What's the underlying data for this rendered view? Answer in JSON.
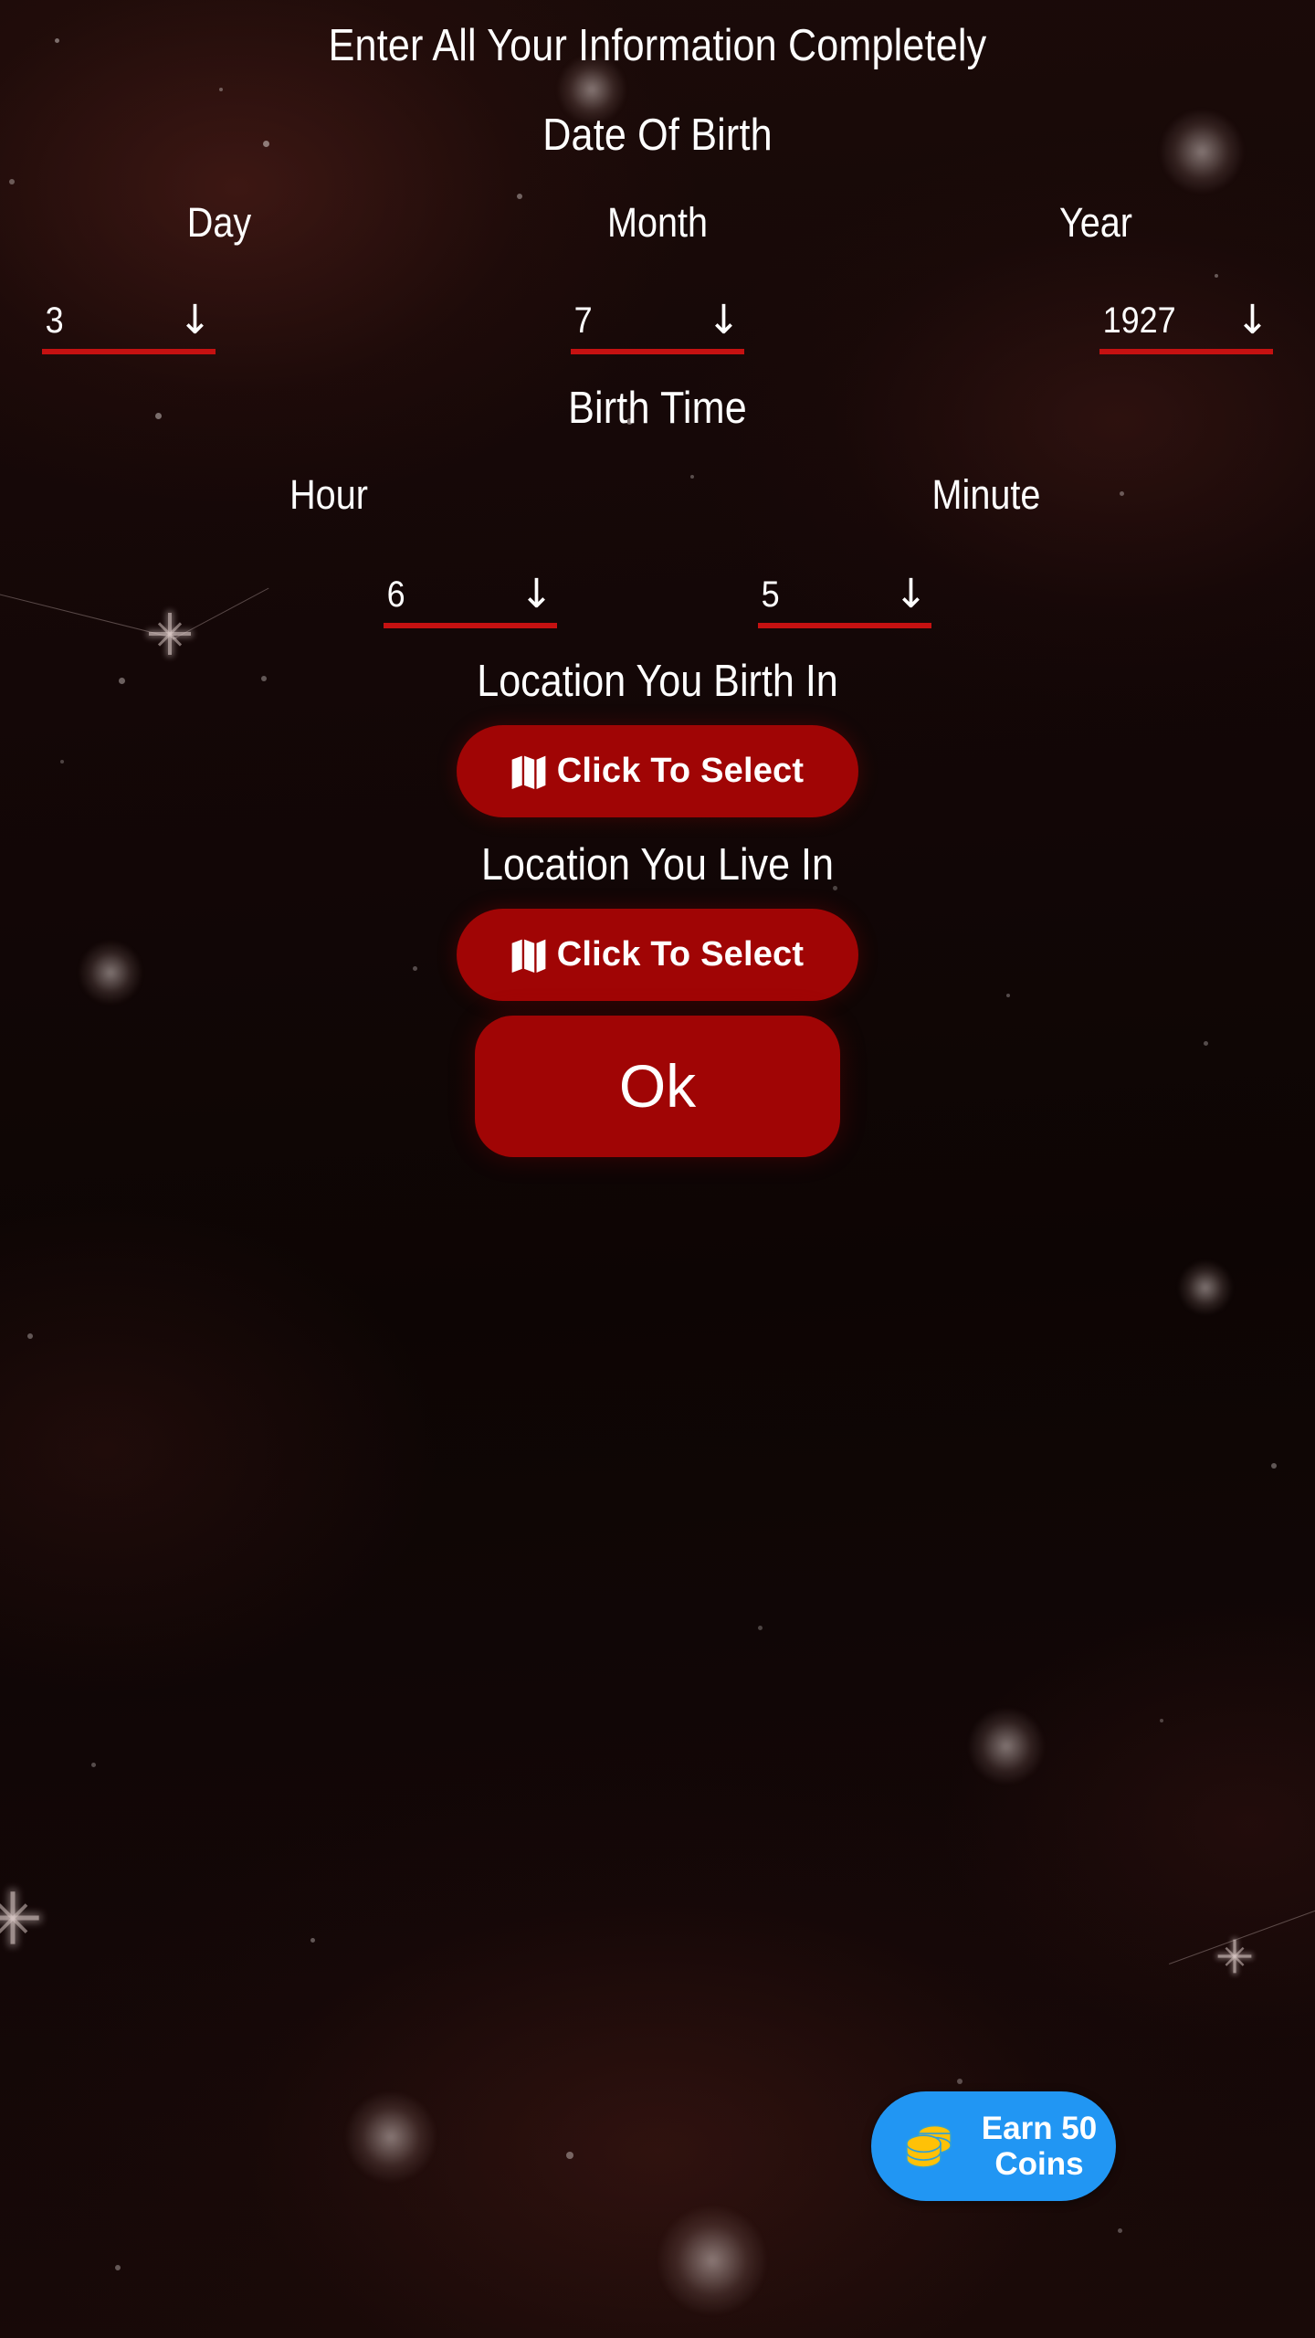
{
  "screen": {
    "title": "Enter All Your Information Completely",
    "background_color": "#140707",
    "accent_red": "#a00505",
    "underline_red": "#c51111",
    "badge_blue": "#2196f3",
    "coin_gold": "#ffc107"
  },
  "date_of_birth": {
    "section_title": "Date Of Birth",
    "fields": [
      {
        "label": "Day",
        "value": "3",
        "icon": "chevron-down-icon"
      },
      {
        "label": "Month",
        "value": "7",
        "icon": "chevron-down-icon"
      },
      {
        "label": "Year",
        "value": "1927",
        "icon": "chevron-down-icon"
      }
    ]
  },
  "birth_time": {
    "section_title": "Birth Time",
    "fields": [
      {
        "label": "Hour",
        "value": "6",
        "icon": "chevron-down-icon"
      },
      {
        "label": "Minute",
        "value": "5",
        "icon": "chevron-down-icon"
      }
    ]
  },
  "birth_location": {
    "label": "Location You Birth In",
    "button_label": "Click To Select",
    "button_icon": "map-icon"
  },
  "live_location": {
    "label": "Location You Live In",
    "button_label": "Click To Select",
    "button_icon": "map-icon"
  },
  "submit": {
    "label": "Ok"
  },
  "coins_badge": {
    "line1": "Earn 50",
    "line2": "Coins",
    "icon": "coins-stack-icon"
  },
  "icons": {
    "down_arrow": "↓"
  }
}
